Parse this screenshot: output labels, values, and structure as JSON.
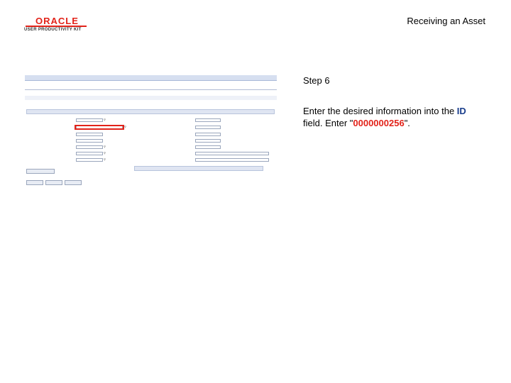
{
  "header": {
    "logo_text": "ORACLE",
    "logo_subtext": "USER PRODUCTIVITY KIT",
    "page_title": "Receiving an Asset"
  },
  "instructions": {
    "step_label": "Step 6",
    "text_before": "Enter the desired information into the ",
    "field_name": "ID",
    "text_middle": " field. Enter \"",
    "value": "0000000256",
    "text_after": "\"."
  },
  "colors": {
    "oracle_red": "#e2231a",
    "link_blue": "#1a3e8c"
  }
}
